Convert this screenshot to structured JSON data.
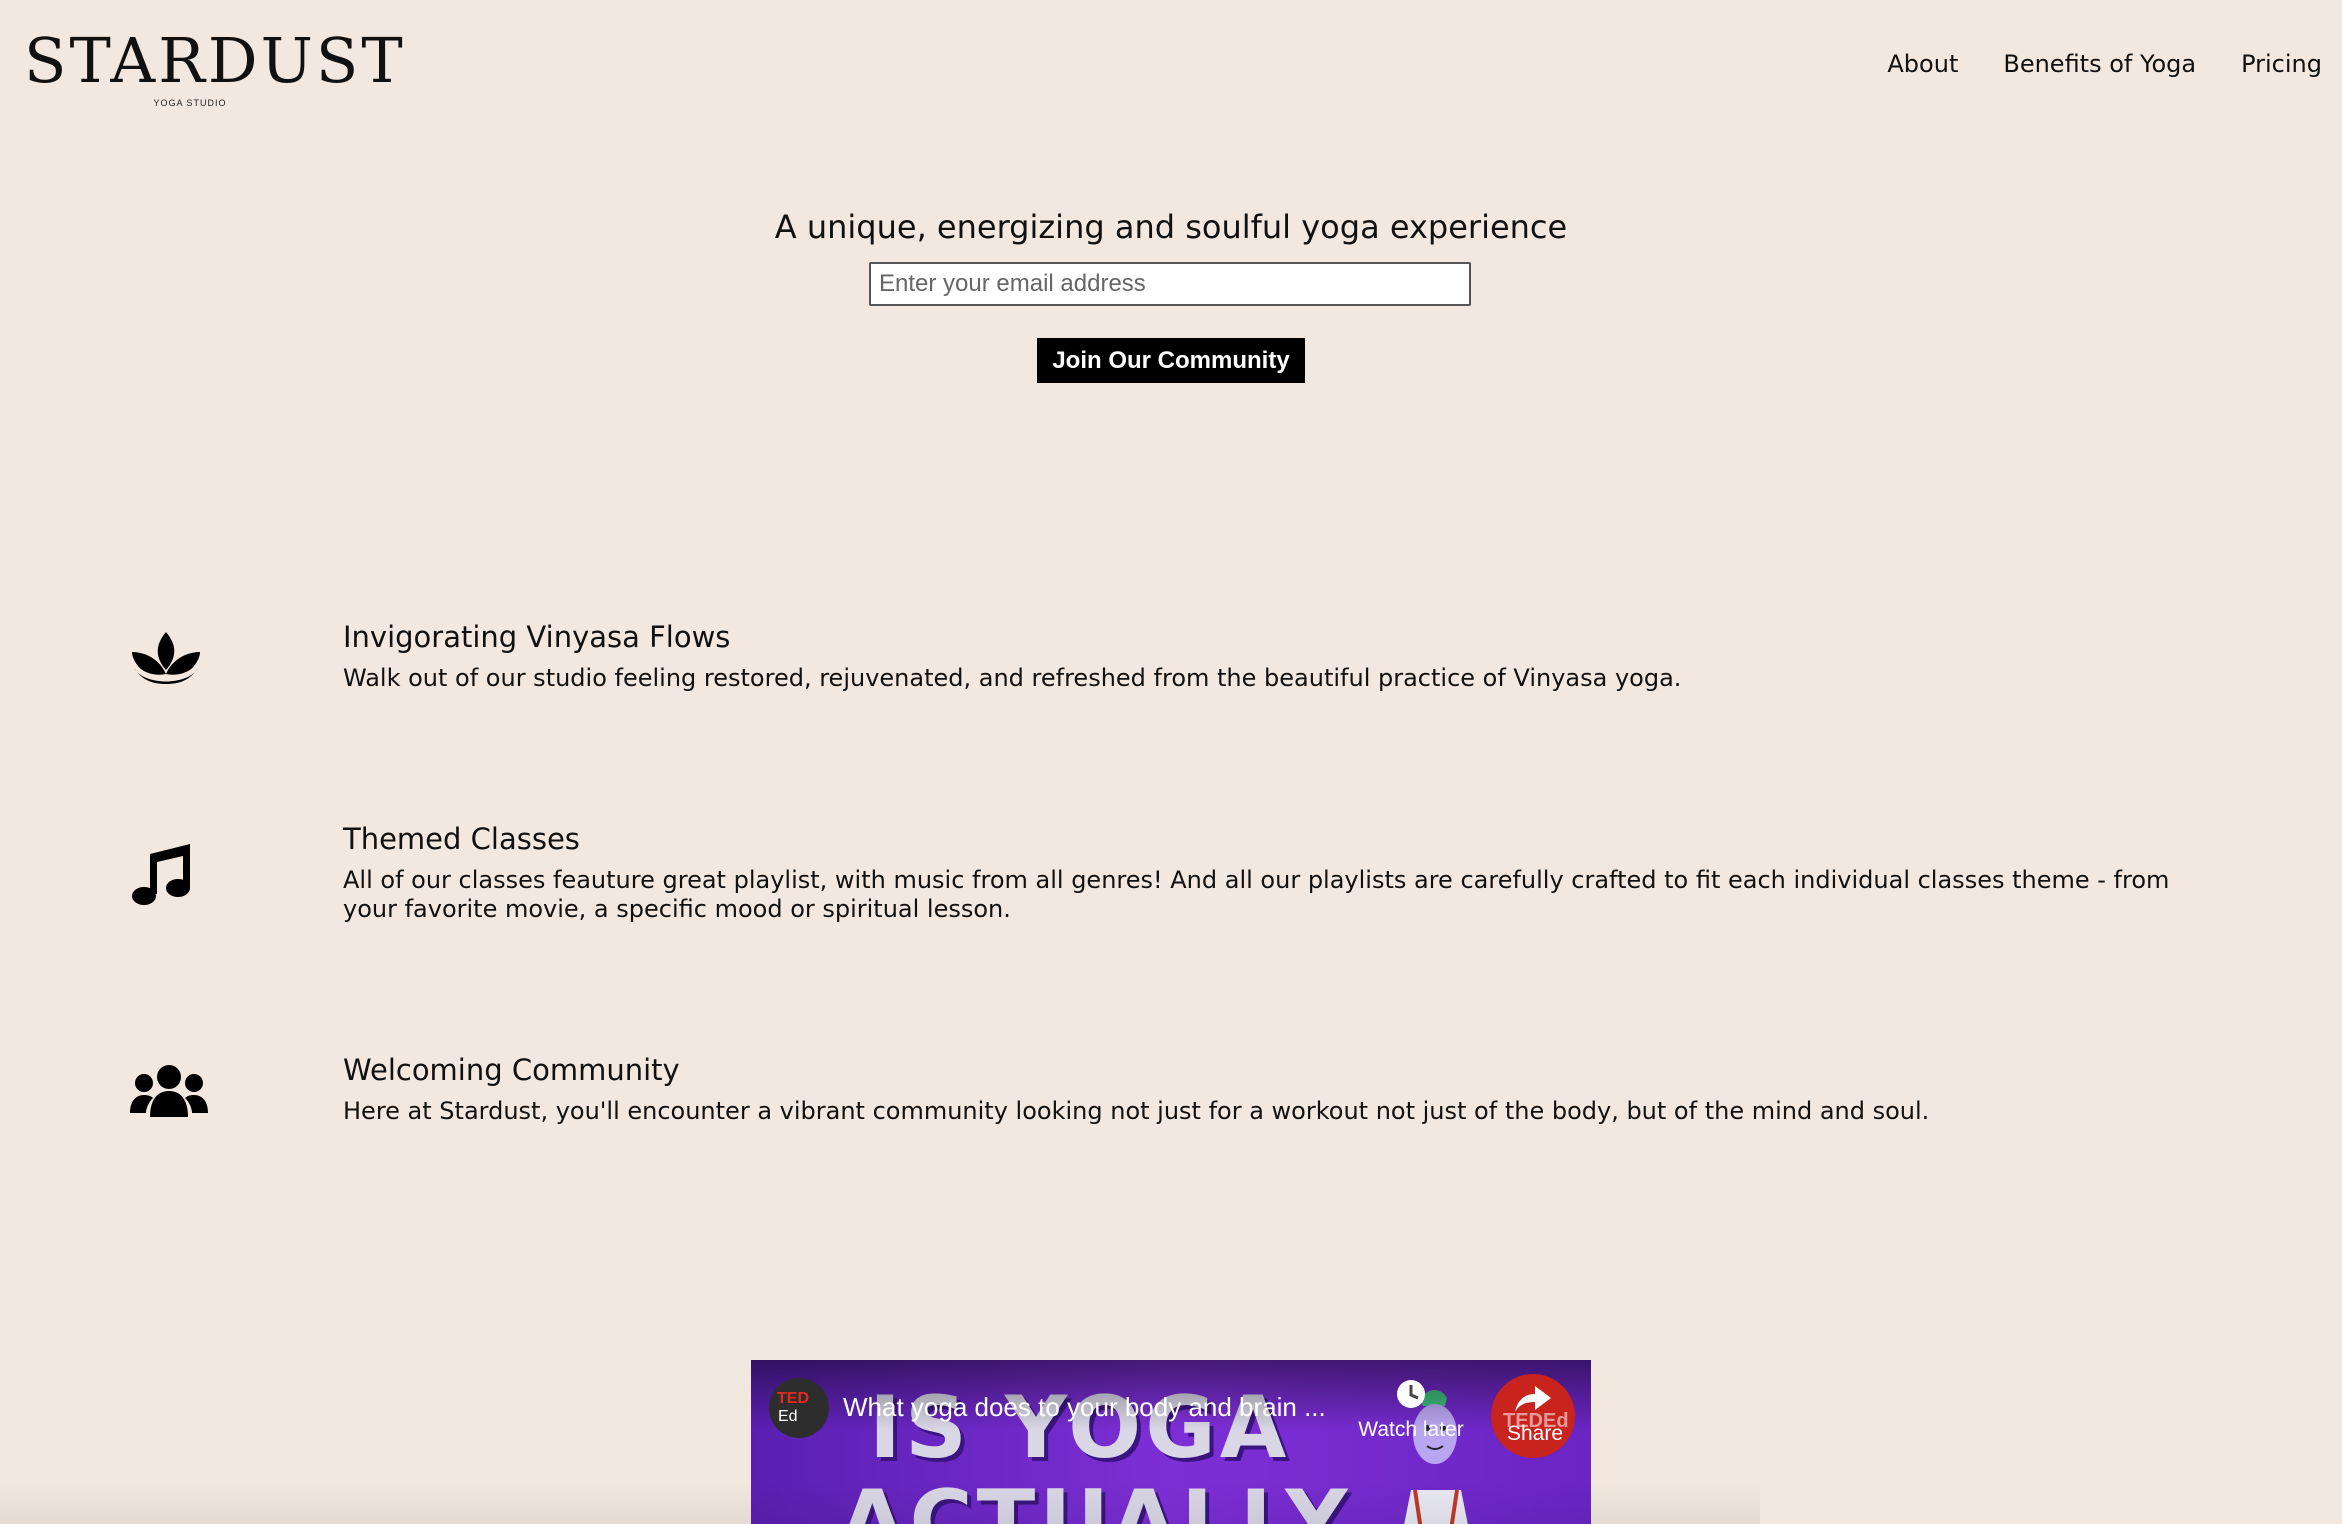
{
  "header": {
    "logo_text": "STARDUST",
    "logo_subtext": "YOGA STUDIO",
    "nav": [
      {
        "label": "About"
      },
      {
        "label": "Benefits of Yoga"
      },
      {
        "label": "Pricing"
      }
    ]
  },
  "hero": {
    "title": "A unique, energizing and soulful yoga experience",
    "email_placeholder": "Enter your email address",
    "join_label": "Join Our Community"
  },
  "features": [
    {
      "icon": "lotus-icon",
      "title": "Invigorating Vinyasa Flows",
      "description": "Walk out of our studio feeling restored, rejuvenated, and refreshed from the beautiful practice of Vinyasa yoga."
    },
    {
      "icon": "music-note-icon",
      "title": "Themed Classes",
      "description": "All of our classes feauture great playlist, with music from all genres! And all our playlists are carefully crafted to fit each individual classes theme - from your favorite movie, a specific mood or spiritual lesson."
    },
    {
      "icon": "users-icon",
      "title": "Welcoming Community",
      "description": "Here at Stardust, you'll encounter a vibrant community looking not just for a workout not just of the body, but of the mind and soul."
    }
  ],
  "video": {
    "channel_badge_top": "TED",
    "channel_badge_bottom": "Ed",
    "title": "What yoga does to your body and brain ...",
    "thumbnail_line1": "IS YOGA",
    "thumbnail_line2": "ACTUALLY",
    "watch_later_label": "Watch later",
    "share_label": "Share",
    "watermark": "TEDEd",
    "colors": {
      "background": "#6a25c4",
      "share": "#c8231d"
    }
  },
  "colors": {
    "page_background": "#f3e8df",
    "button": "#000000"
  }
}
